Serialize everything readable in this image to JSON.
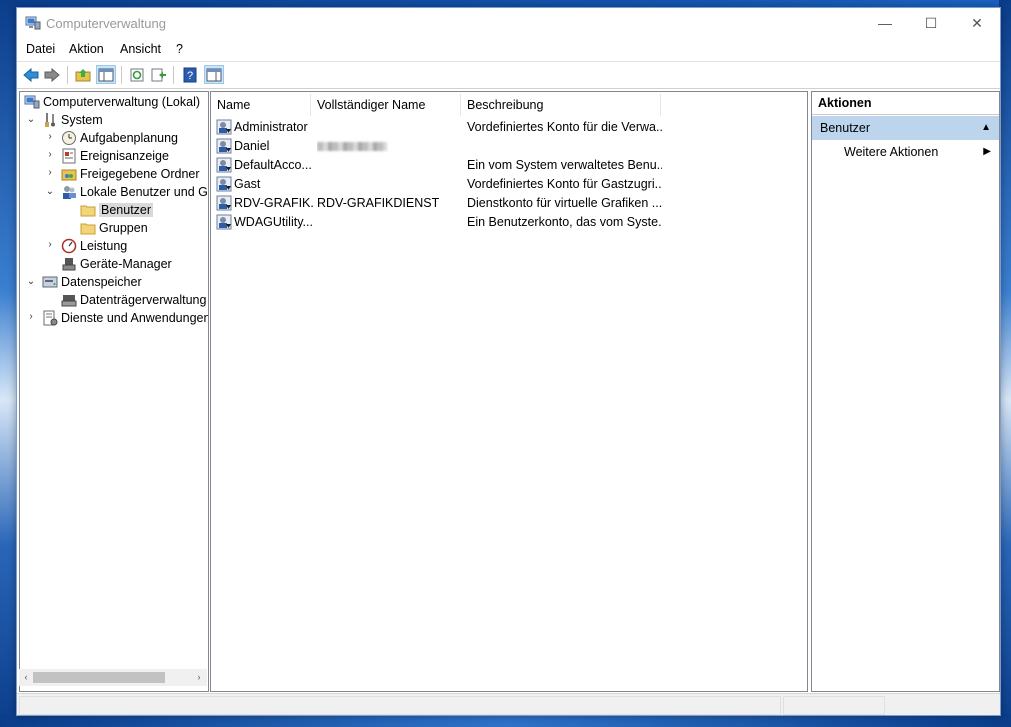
{
  "window": {
    "title": "Computerverwaltung",
    "controls": {
      "minimize": "—",
      "maximize": "☐",
      "close": "✕"
    }
  },
  "menu": [
    "Datei",
    "Aktion",
    "Ansicht",
    "?"
  ],
  "toolbar": {
    "buttons": [
      "back-icon",
      "forward-icon",
      "up-folder-icon",
      "show-hide-tree-icon",
      "refresh-icon",
      "export-list-icon",
      "help-icon",
      "show-hide-action-pane-icon"
    ]
  },
  "tree": {
    "root": "Computerverwaltung (Lokal)",
    "system": "System",
    "task_scheduler": "Aufgabenplanung",
    "event_viewer": "Ereignisanzeige",
    "shared_folders": "Freigegebene Ordner",
    "local_users": "Lokale Benutzer und Gruppen",
    "users": "Benutzer",
    "groups": "Gruppen",
    "performance": "Leistung",
    "device_manager": "Geräte-Manager",
    "storage": "Datenspeicher",
    "disk_management": "Datenträgerverwaltung",
    "services": "Dienste und Anwendungen"
  },
  "list": {
    "columns": [
      "Name",
      "Vollständiger Name",
      "Beschreibung"
    ],
    "rows": [
      {
        "name": "Administrator",
        "full_name": "",
        "description": "Vordefiniertes Konto für die Verwa...",
        "blurred": false
      },
      {
        "name": "Daniel",
        "full_name": "",
        "description": "",
        "blurred": true
      },
      {
        "name": "DefaultAcco...",
        "full_name": "",
        "description": "Ein vom System verwaltetes Benu...",
        "blurred": false
      },
      {
        "name": "Gast",
        "full_name": "",
        "description": "Vordefiniertes Konto für Gastzugri...",
        "blurred": false
      },
      {
        "name": "RDV-GRAFIK...",
        "full_name": "RDV-GRAFIKDIENST",
        "description": "Dienstkonto für virtuelle Grafiken ...",
        "blurred": false
      },
      {
        "name": "WDAGUtility...",
        "full_name": "",
        "description": "Ein Benutzerkonto, das vom Syste...",
        "blurred": false
      }
    ]
  },
  "actions": {
    "header": "Aktionen",
    "section": "Benutzer",
    "more": "Weitere Aktionen"
  }
}
